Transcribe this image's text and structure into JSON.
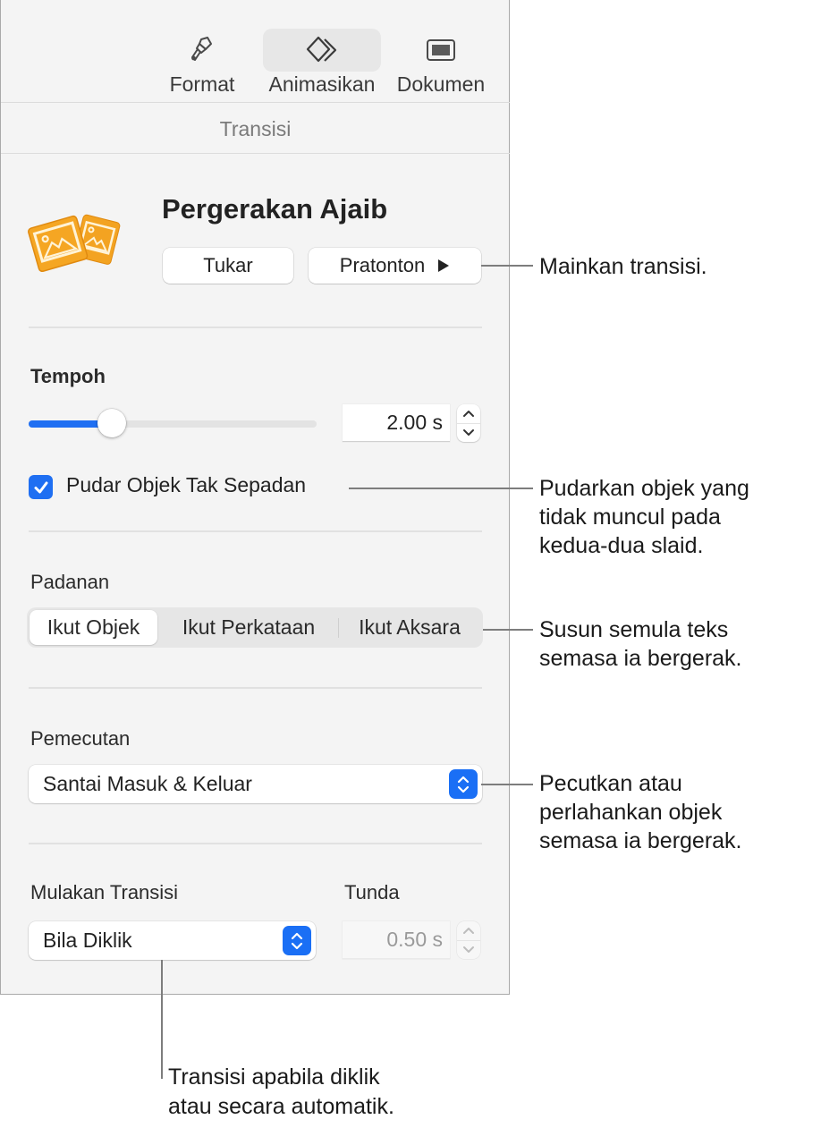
{
  "toolbar": {
    "tabs": [
      {
        "label": "Format",
        "icon": "paintbrush-icon",
        "active": false
      },
      {
        "label": "Animasikan",
        "icon": "animate-diamonds-icon",
        "active": true
      },
      {
        "label": "Dokumen",
        "icon": "document-icon",
        "active": false
      }
    ]
  },
  "section_tab": "Transisi",
  "transition": {
    "icon": "magic-move-photos-icon",
    "title": "Pergerakan Ajaib",
    "change_button": "Tukar",
    "preview_button": "Pratonton",
    "preview_icon": "play-icon"
  },
  "duration": {
    "label": "Tempoh",
    "slider_fraction": 0.29,
    "value": "2.00 s"
  },
  "fade_checkbox": {
    "label": "Pudar Objek Tak Sepadan",
    "checked": true
  },
  "matching": {
    "label": "Padanan",
    "segments": [
      "Ikut Objek",
      "Ikut Perkataan",
      "Ikut Aksara"
    ],
    "selected": "Ikut Objek"
  },
  "acceleration": {
    "label": "Pemecutan",
    "value": "Santai Masuk & Keluar"
  },
  "start_transition": {
    "label": "Mulakan Transisi",
    "value": "Bila Diklik"
  },
  "delay": {
    "label": "Tunda",
    "value": "0.50 s",
    "disabled": true
  },
  "callouts": {
    "play": [
      "Mainkan transisi."
    ],
    "fade": [
      "Pudarkan objek yang",
      "tidak muncul pada",
      "kedua-dua slaid."
    ],
    "matching": [
      "Susun semula teks",
      "semasa ia bergerak."
    ],
    "acceleration": [
      "Pecutkan atau",
      "perlahankan objek",
      "semasa ia bergerak."
    ],
    "start": [
      "Transisi apabila diklik",
      "atau secara automatik."
    ]
  },
  "colors": {
    "accent": "#1f6ff2",
    "icon_orange": "#f3a321"
  }
}
